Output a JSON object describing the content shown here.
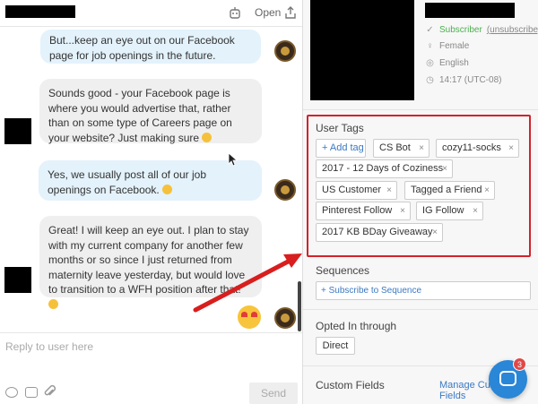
{
  "chat": {
    "header": {
      "open_label": "Open"
    },
    "messages": [
      {
        "from": "bot",
        "text": "But...keep an eye out on our Facebook page for job openings in the future."
      },
      {
        "from": "user",
        "text": "Sounds good - your Facebook page is where you would advertise that, rather than on some type of Careers page on your website? Just making sure"
      },
      {
        "from": "bot",
        "text": "Yes, we usually post all of our job openings on Facebook."
      },
      {
        "from": "user",
        "text": "Great! I will keep an eye out. I plan to stay with my current company for another few months or so since I just returned from maternity leave yesterday, but would love to transition to a WFH position after that!"
      }
    ],
    "composer": {
      "placeholder": "Reply to user here",
      "send_label": "Send"
    }
  },
  "profile": {
    "status": "Subscriber",
    "unsubscribe_label": "(unsubscribe)",
    "gender": "Female",
    "language": "English",
    "time": "14:17 (UTC-08)",
    "user_tags": {
      "title": "User Tags",
      "add_label": "+ Add tag",
      "tags": [
        "CS Bot",
        "cozy11-socks",
        "2017 - 12 Days of Coziness",
        "US Customer",
        "Tagged a Friend",
        "Pinterest Follow",
        "IG Follow",
        "2017 KB BDay Giveaway"
      ],
      "remove_symbol": "×"
    },
    "sequences": {
      "title": "Sequences",
      "subscribe_label": "+ Subscribe to Sequence"
    },
    "opted_in": {
      "title": "Opted In through",
      "value": "Direct"
    },
    "custom_fields": {
      "title": "Custom Fields",
      "manage_label": "Manage Custom Fields"
    }
  },
  "messenger_badge": {
    "count": "3"
  },
  "colors": {
    "highlight": "#d3222a",
    "link": "#3b79c4",
    "subscriber": "#4caf50",
    "messenger": "#2a86d6"
  }
}
